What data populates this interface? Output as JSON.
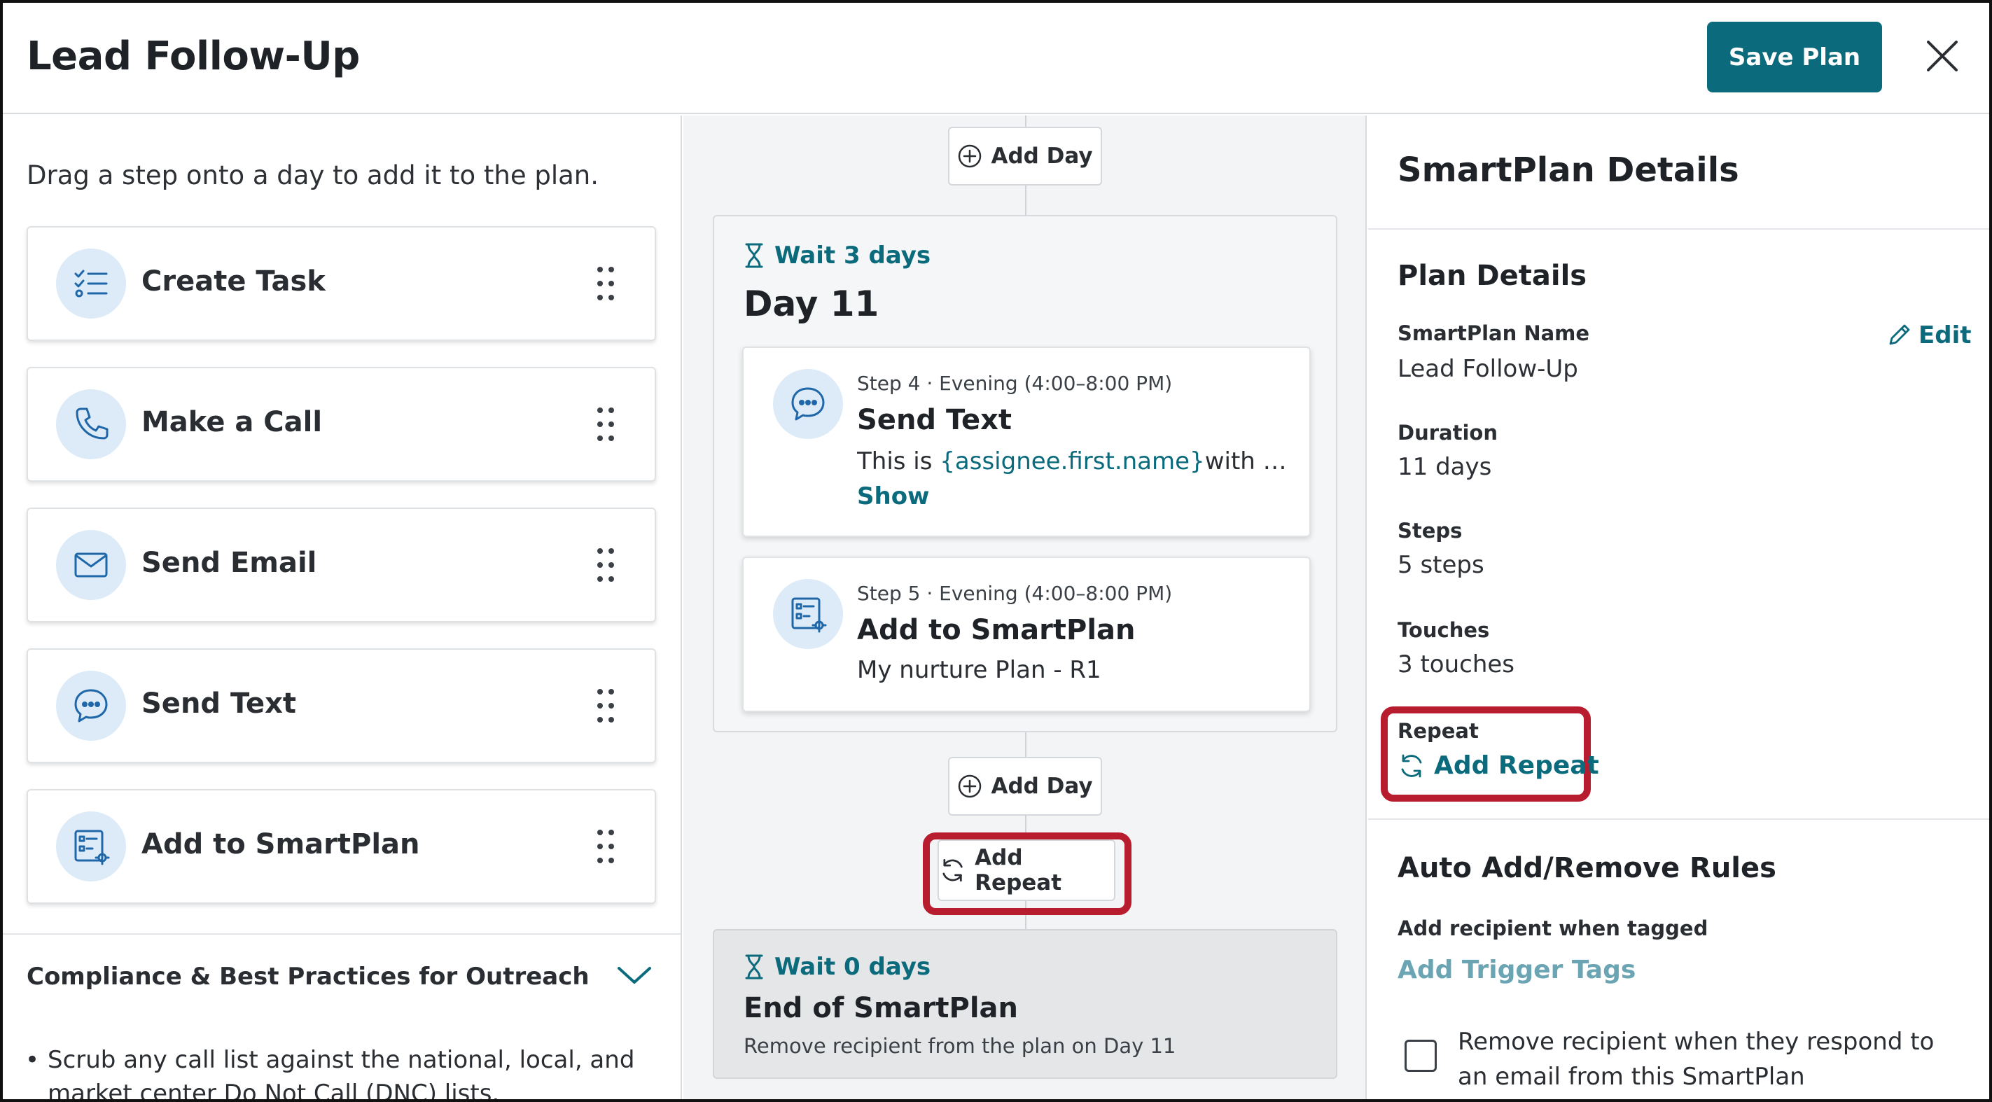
{
  "header": {
    "title": "Lead Follow-Up",
    "save_label": "Save Plan",
    "close_icon": "close-icon"
  },
  "left": {
    "hint": "Drag a step onto a day to add it to the plan.",
    "steps": [
      {
        "label": "Create Task",
        "icon": "task-list-icon"
      },
      {
        "label": "Make a Call",
        "icon": "phone-icon"
      },
      {
        "label": "Send Email",
        "icon": "envelope-icon"
      },
      {
        "label": "Send Text",
        "icon": "chat-bubble-icon"
      },
      {
        "label": "Add to SmartPlan",
        "icon": "smartplan-icon"
      }
    ],
    "compliance": {
      "title": "Compliance & Best Practices for Outreach",
      "items": [
        "Scrub any call list against the national, local, and market center Do Not Call (DNC) lists."
      ]
    }
  },
  "middle": {
    "add_day_label": "Add Day",
    "day": {
      "wait": "Wait 3 days",
      "title": "Day 11",
      "steps": [
        {
          "meta": "Step 4 · Evening (4:00–8:00 PM)",
          "name": "Send Text",
          "body_prefix": "This is ",
          "body_var": "{assignee.first.name}",
          "body_suffix": "with Keller Williams",
          "show_label": "Show"
        },
        {
          "meta": "Step 5 · Evening (4:00–8:00 PM)",
          "name": "Add to SmartPlan",
          "body": "My nurture Plan - R1"
        }
      ]
    },
    "add_repeat_label": "Add Repeat",
    "end": {
      "wait": "Wait 0 days",
      "title": "End of SmartPlan",
      "subtitle": "Remove recipient from the plan on Day 11"
    }
  },
  "right": {
    "title": "SmartPlan Details",
    "plan_details": {
      "section_title": "Plan Details",
      "name_label": "SmartPlan Name",
      "name_value": "Lead Follow-Up",
      "edit_label": "Edit",
      "duration_label": "Duration",
      "duration_value": "11 days",
      "steps_label": "Steps",
      "steps_value": "5 steps",
      "touches_label": "Touches",
      "touches_value": "3 touches",
      "repeat_label": "Repeat",
      "add_repeat_label": "Add Repeat"
    },
    "rules": {
      "section_title": "Auto Add/Remove Rules",
      "tagged_label": "Add recipient when tagged",
      "trigger_link": "Add Trigger Tags",
      "remove_label": "Remove recipient when they respond to an email from this SmartPlan"
    }
  },
  "colors": {
    "accent": "#0b6b7c",
    "highlight": "#b81d2f",
    "icon_bg": "#dcebf7"
  }
}
